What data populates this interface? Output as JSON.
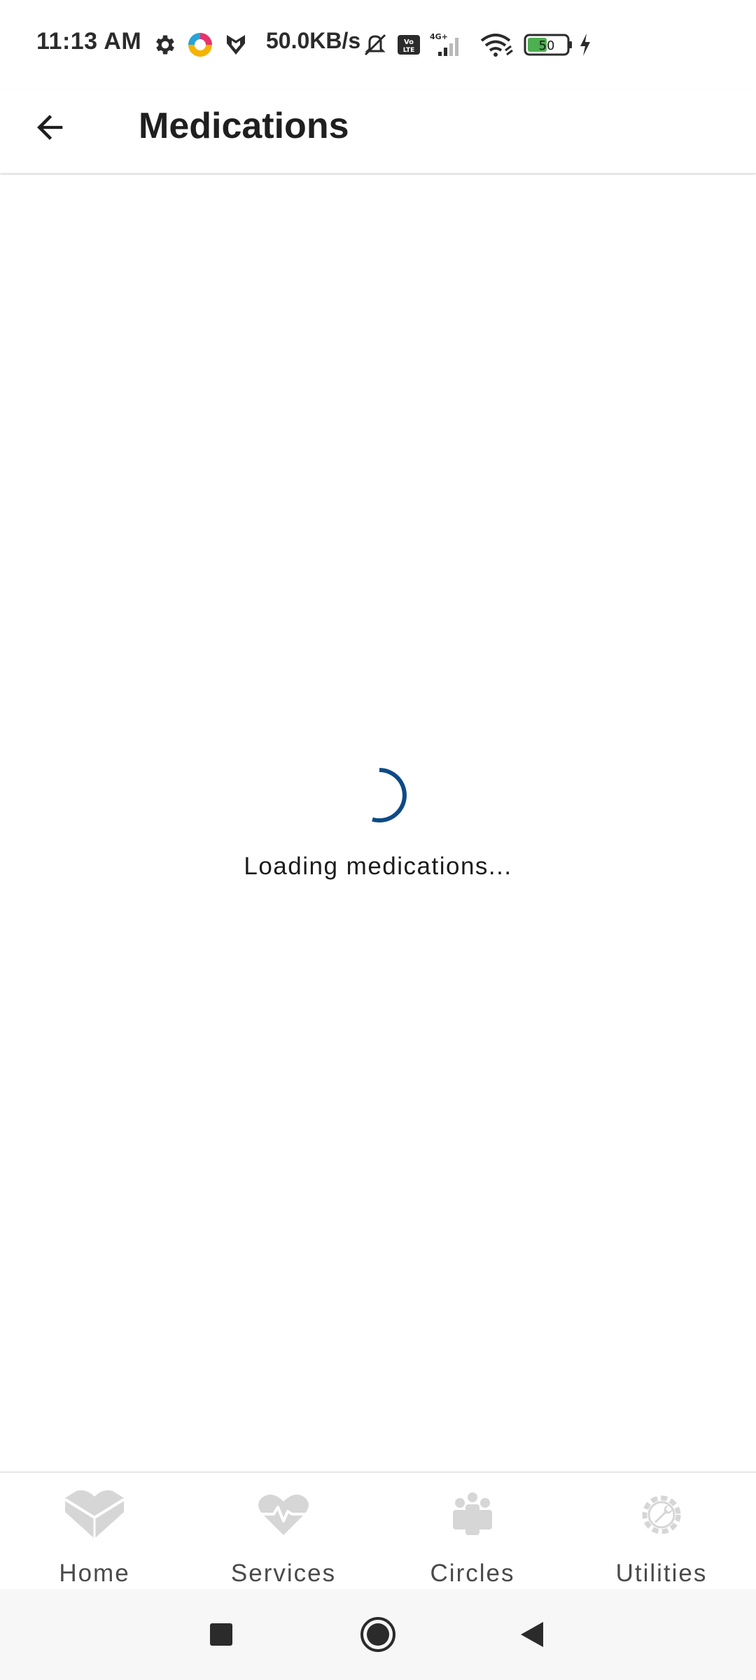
{
  "status_bar": {
    "time": "11:13 AM",
    "net_speed": "50.0KB/s",
    "battery_level": "50",
    "icons": [
      "gear-icon",
      "app-color-icon",
      "shield-app-icon",
      "mute-icon",
      "volte-icon",
      "signal-4g-icon",
      "wifi-icon",
      "battery-icon",
      "charging-icon"
    ]
  },
  "app_bar": {
    "back_icon": "arrow-left-icon",
    "title": "Medications"
  },
  "content": {
    "loading_text": "Loading medications...",
    "spinner_color": "#0d4a86"
  },
  "bottom_nav": {
    "items": [
      {
        "label": "Home",
        "icon": "home-heart-icon"
      },
      {
        "label": "Services",
        "icon": "heart-pulse-icon"
      },
      {
        "label": "Circles",
        "icon": "people-group-icon"
      },
      {
        "label": "Utilities",
        "icon": "gear-wrench-icon"
      }
    ],
    "icon_color": "#d6d6d6"
  },
  "system_nav": {
    "buttons": [
      "recents-square-icon",
      "home-circle-icon",
      "back-triangle-icon"
    ]
  }
}
